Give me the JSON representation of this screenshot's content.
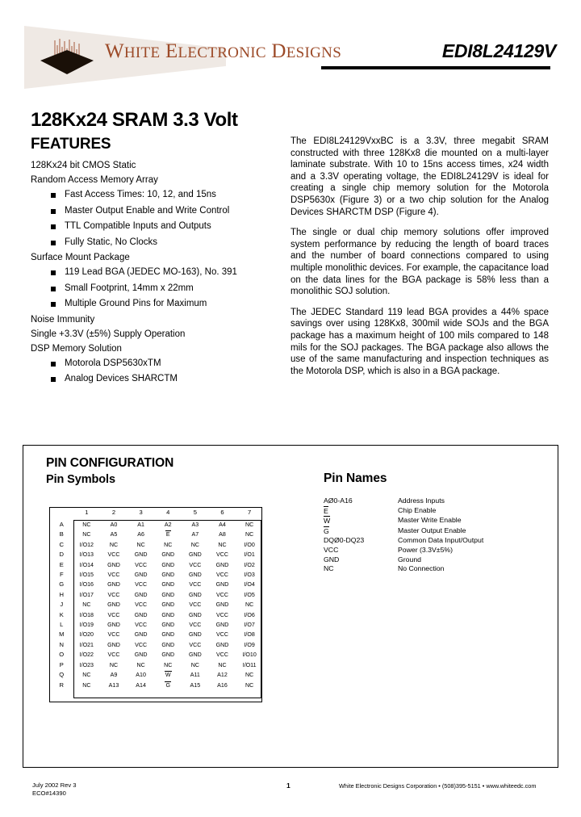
{
  "header": {
    "company": {
      "part1": "W",
      "part1b": "HITE",
      "part2": "E",
      "part2b": "LECTRONIC",
      "part3": "D",
      "part3b": "ESIGNS"
    },
    "company_full": "WHITE ELECTRONIC DESIGNS",
    "part_number": "EDI8L24129V"
  },
  "doc_title": "128Kx24 SRAM 3.3 Volt",
  "features": {
    "heading": "FEATURES",
    "intro_line1": "128Kx24 bit CMOS Static",
    "intro_line2": "Random Access Memory Array",
    "group1": [
      "Fast Access Times: 10, 12, and 15ns",
      "Master Output Enable and Write Control",
      "TTL Compatible Inputs and Outputs",
      "Fully Static, No Clocks"
    ],
    "line_surface_mount": "Surface Mount Package",
    "group2": [
      "119 Lead BGA (JEDEC MO-163), No. 391",
      "Small Footprint, 14mm x 22mm",
      "Multiple Ground Pins for Maximum"
    ],
    "line_noise": "Noise Immunity",
    "line_supply": "Single +3.3V (±5%) Supply Operation",
    "line_dsp": "DSP Memory Solution",
    "group3": [
      "Motorola DSP5630xTM",
      "Analog Devices SHARCTM"
    ]
  },
  "description": {
    "p1": "The EDI8L24129VxxBC is a 3.3V, three megabit SRAM constructed with three 128Kx8 die mounted on a multi-layer laminate substrate.  With 10 to 15ns access times, x24 width and a 3.3V operating voltage, the EDI8L24129V is ideal for creating a single chip memory solution for the Motorola DSP5630x (Figure 3) or a two chip solution for the Analog Devices SHARCTM DSP (Figure 4).",
    "p2": "The single or dual chip memory solutions offer improved system performance by reducing the length of board traces and the number of board connections compared to using multiple monolithic devices.  For example, the capacitance load on the data lines for the BGA package is 58% less than a monolithic SOJ solution.",
    "p3": "The JEDEC Standard 119 lead BGA provides a 44% space savings over using 128Kx8, 300mil wide SOJs and the BGA package has a maximum height of 100 mils compared to 148 mils for the SOJ packages.  The BGA package also allows the use of the same manufacturing and inspection techniques as the Motorola DSP, which is also in a BGA package."
  },
  "pin_configuration": {
    "title": "PIN CONFIGURATION",
    "symbols_title": "Pin Symbols",
    "names_title": "Pin Names",
    "pin_names": [
      {
        "symbol": "AØ0-A16",
        "overline": "",
        "desc": "Address Inputs"
      },
      {
        "symbol": "",
        "overline": "E",
        "desc": "Chip Enable"
      },
      {
        "symbol": "",
        "overline": "W",
        "desc": "Master Write Enable"
      },
      {
        "symbol": "",
        "overline": "G",
        "desc": "Master Output Enable"
      },
      {
        "symbol": "DQØ0-DQ23",
        "overline": "",
        "desc": "Common Data Input/Output"
      },
      {
        "symbol": "VCC",
        "overline": "",
        "desc": "Power  (3.3V±5%)"
      },
      {
        "symbol": "GND",
        "overline": "",
        "desc": "Ground"
      },
      {
        "symbol": "NC",
        "overline": "",
        "desc": "No Connection"
      }
    ],
    "grid": {
      "columns": [
        "1",
        "2",
        "3",
        "4",
        "5",
        "6",
        "7"
      ],
      "rows": [
        {
          "label": "A",
          "cells": [
            "NC",
            "A0",
            "A1",
            "A2",
            "A3",
            "A4",
            "NC"
          ]
        },
        {
          "label": "B",
          "cells": [
            "NC",
            "A5",
            "A6",
            "#E",
            "A7",
            "A8",
            "NC"
          ]
        },
        {
          "label": "C",
          "cells": [
            "I/O12",
            "NC",
            "NC",
            "NC",
            "NC",
            "NC",
            "I/O0"
          ]
        },
        {
          "label": "D",
          "cells": [
            "I/O13",
            "VCC",
            "GND",
            "GND",
            "GND",
            "VCC",
            "I/O1"
          ]
        },
        {
          "label": "E",
          "cells": [
            "I/O14",
            "GND",
            "VCC",
            "GND",
            "VCC",
            "GND",
            "I/O2"
          ]
        },
        {
          "label": "F",
          "cells": [
            "I/O15",
            "VCC",
            "GND",
            "GND",
            "GND",
            "VCC",
            "I/O3"
          ]
        },
        {
          "label": "G",
          "cells": [
            "I/O16",
            "GND",
            "VCC",
            "GND",
            "VCC",
            "GND",
            "I/O4"
          ]
        },
        {
          "label": "H",
          "cells": [
            "I/O17",
            "VCC",
            "GND",
            "GND",
            "GND",
            "VCC",
            "I/O5"
          ]
        },
        {
          "label": "J",
          "cells": [
            "NC",
            "GND",
            "VCC",
            "GND",
            "VCC",
            "GND",
            "NC"
          ]
        },
        {
          "label": "K",
          "cells": [
            "I/O18",
            "VCC",
            "GND",
            "GND",
            "GND",
            "VCC",
            "I/O6"
          ]
        },
        {
          "label": "L",
          "cells": [
            "I/O19",
            "GND",
            "VCC",
            "GND",
            "VCC",
            "GND",
            "I/O7"
          ]
        },
        {
          "label": "M",
          "cells": [
            "I/O20",
            "VCC",
            "GND",
            "GND",
            "GND",
            "VCC",
            "I/O8"
          ]
        },
        {
          "label": "N",
          "cells": [
            "I/O21",
            "GND",
            "VCC",
            "GND",
            "VCC",
            "GND",
            "I/O9"
          ]
        },
        {
          "label": "O",
          "cells": [
            "I/O22",
            "VCC",
            "GND",
            "GND",
            "GND",
            "VCC",
            "I/O10"
          ]
        },
        {
          "label": "P",
          "cells": [
            "I/O23",
            "NC",
            "NC",
            "NC",
            "NC",
            "NC",
            "I/O11"
          ]
        },
        {
          "label": "Q",
          "cells": [
            "NC",
            "A9",
            "A10",
            "#W",
            "A11",
            "A12",
            "NC"
          ]
        },
        {
          "label": "R",
          "cells": [
            "NC",
            "A13",
            "A14",
            "#G",
            "A15",
            "A16",
            "NC"
          ]
        }
      ]
    }
  },
  "footer": {
    "date_rev": "July 2002 Rev 3",
    "eco": "ECO#14390",
    "page": "1",
    "right": "White Electronic Designs Corporation • (508)395-5151 • www.whiteedc.com"
  },
  "colors": {
    "brand": "#9c4a28",
    "wedge": "#efe9e4",
    "ink": "#000000"
  }
}
